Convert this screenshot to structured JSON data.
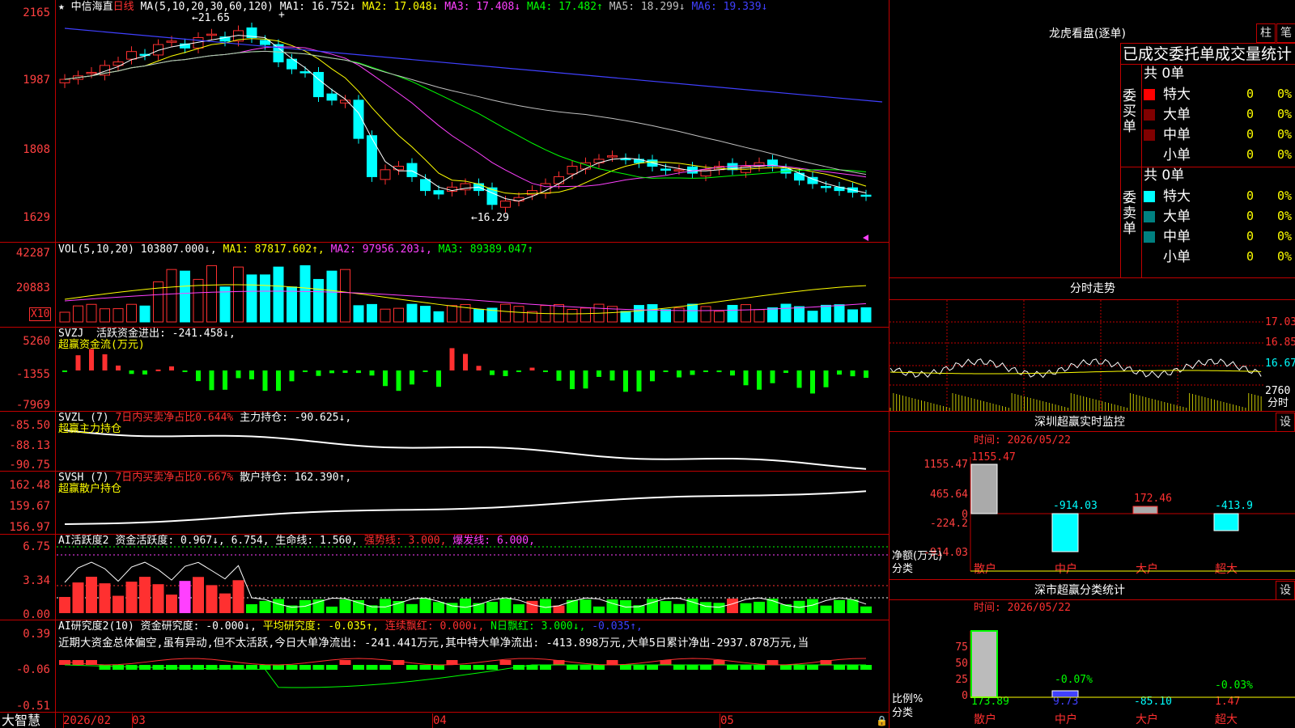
{
  "main": {
    "name": "中信海直",
    "period": "日线",
    "ma_header": "MA(5,10,20,30,60,120)",
    "ma": [
      {
        "label": "MA1: 16.752↓",
        "color": "#ffffff"
      },
      {
        "label": "MA2: 17.048↓",
        "color": "#ffff00"
      },
      {
        "label": "MA3: 17.408↓",
        "color": "#ff40ff"
      },
      {
        "label": "MA4: 17.482↑",
        "color": "#00ff00"
      },
      {
        "label": "MA5: 18.299↓",
        "color": "#c0c0c0"
      },
      {
        "label": "MA6: 19.339↓",
        "color": "#4040ff"
      }
    ],
    "y_ticks": [
      "2165",
      "1987",
      "1808",
      "1629"
    ],
    "high_label": "←21.65",
    "low_label": "←16.29"
  },
  "vol": {
    "header": "VOL(5,10,20)",
    "value": "103807.000↓,",
    "ma1": "MA1: 87817.602↑,",
    "ma2": "MA2: 97956.203↓,",
    "ma3": "MA3: 89389.047↑",
    "y_ticks": [
      "42287",
      "20883"
    ],
    "unit": "X10"
  },
  "svzj": {
    "header": "SVZJ",
    "text": "活跃资金进出: -241.458↓,",
    "sub": "超赢资金流(万元)",
    "y_ticks": [
      "5260",
      "-1355",
      "-7969"
    ]
  },
  "svzl": {
    "header": "SVZL (7)",
    "ratio": "7日内买卖净占比0.644%",
    "text": "主力持仓: -90.625↓,",
    "sub": "超赢主力持仓",
    "y_ticks": [
      "-85.50",
      "-88.13",
      "-90.75"
    ]
  },
  "svsh": {
    "header": "SVSH (7)",
    "ratio": "7日内买卖净占比0.667%",
    "text": "散户持仓: 162.390↑,",
    "sub": "超赢散户持仓",
    "y_ticks": [
      "162.48",
      "159.67",
      "156.97"
    ]
  },
  "ai_active": {
    "header": "AI活跃度2",
    "t1": "资金活跃度: 0.967↓,",
    "t2": "6.754,",
    "t3": "生命线: 1.560,",
    "t4": "强势线: 3.000,",
    "t5": "爆发线: 6.000,",
    "y_ticks": [
      "6.75",
      "3.34",
      "0.00"
    ]
  },
  "ai_research": {
    "header": "AI研究度2(10)",
    "t1": "资金研究度: -0.000↓,",
    "t2": "平均研究度: -0.035↑,",
    "t3": "连续飘红: 0.000↓,",
    "t4": "N日飘红: 3.000↓,",
    "t5": "-0.035↑,",
    "comment": "近期大资金总体偏空,虽有异动,但不太活跃,今日大单净流出: -241.441万元,其中特大单净流出: -413.898万元,大单5日累计净出-2937.878万元,当",
    "y_ticks": [
      "0.39",
      "-0.06",
      "-0.51"
    ]
  },
  "bottom": {
    "brand": "大智慧",
    "months": [
      "2026/02",
      "03",
      "04",
      "05"
    ]
  },
  "right": {
    "lhb_title": "龙虎看盘(逐单)",
    "btn_zhu": "柱",
    "btn_bi": "笔",
    "stats_title": "已成交委托单成交量统计",
    "buy_side": "委买单",
    "sell_side": "委卖单",
    "buy_total": "共 0单",
    "sell_total": "共 0单",
    "buy_rows": [
      {
        "label": "特大",
        "count": "0",
        "pct": "0%",
        "color": "#ff0000"
      },
      {
        "label": "大单",
        "count": "0",
        "pct": "0%",
        "color": "#800000"
      },
      {
        "label": "中单",
        "count": "0",
        "pct": "0%",
        "color": "#800000"
      },
      {
        "label": "小单",
        "count": "0",
        "pct": "0%",
        "color": ""
      }
    ],
    "sell_rows": [
      {
        "label": "特大",
        "count": "0",
        "pct": "0%",
        "color": "#00ffff"
      },
      {
        "label": "大单",
        "count": "0",
        "pct": "0%",
        "color": "#008080"
      },
      {
        "label": "中单",
        "count": "0",
        "pct": "0%",
        "color": "#008080"
      },
      {
        "label": "小单",
        "count": "0",
        "pct": "0%",
        "color": ""
      }
    ],
    "intraday_title": "分时走势",
    "intraday_ticks": [
      "17.03",
      "16.85",
      "16.67",
      "2760"
    ],
    "intraday_unit": "分时",
    "monitor_title": "深圳超赢实时监控",
    "monitor_btn": "设",
    "monitor_time": "时间: 2026/05/22",
    "monitor_y": [
      "1155.47",
      "465.64",
      "0",
      "-224.2",
      "-914.03"
    ],
    "monitor_unit": "净额(万元)",
    "monitor_cat": "分类",
    "monitor_values": [
      "1155.47",
      "-914.03",
      "172.46",
      "-413.9"
    ],
    "monitor_labels": [
      "散户",
      "中户",
      "大户",
      "超大"
    ],
    "class_title": "深市超赢分类统计",
    "class_btn": "设",
    "class_time": "时间: 2026/05/22",
    "class_y": [
      "75",
      "50",
      "25",
      "0"
    ],
    "class_unit": "比例%",
    "class_cat": "分类",
    "class_top": [
      "-0.07%",
      "-0.03%"
    ],
    "class_values": [
      "173.89",
      "9.73",
      "-85.10",
      "1.47"
    ],
    "class_labels": [
      "散户",
      "中户",
      "大户",
      "超大"
    ]
  }
}
